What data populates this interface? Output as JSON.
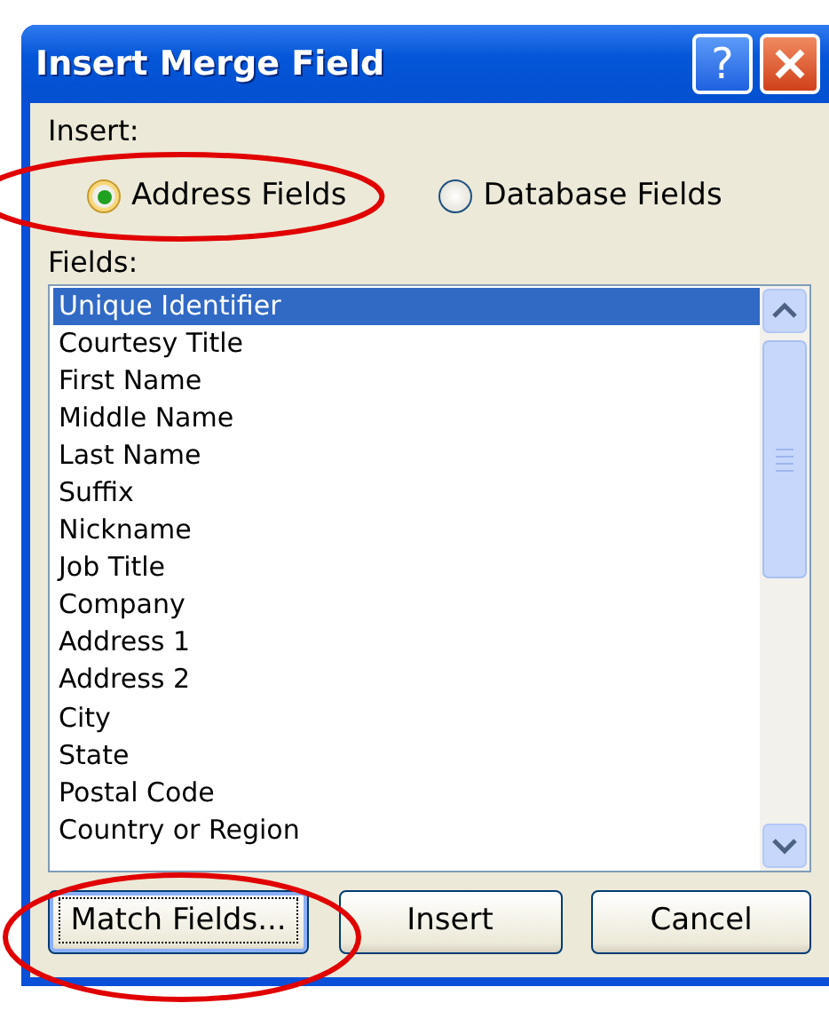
{
  "window": {
    "title": "Insert Merge Field",
    "help_button": "?"
  },
  "insert_label": "Insert:",
  "options": [
    {
      "label": "Address Fields",
      "selected": true,
      "circled": true
    },
    {
      "label": "Database Fields",
      "selected": false,
      "circled": false
    }
  ],
  "fields_label": "Fields:",
  "fields": [
    {
      "label": "Unique Identifier",
      "selected": true
    },
    {
      "label": "Courtesy Title",
      "selected": false
    },
    {
      "label": "First Name",
      "selected": false
    },
    {
      "label": "Middle Name",
      "selected": false
    },
    {
      "label": "Last Name",
      "selected": false
    },
    {
      "label": "Suffix",
      "selected": false
    },
    {
      "label": "Nickname",
      "selected": false
    },
    {
      "label": "Job Title",
      "selected": false
    },
    {
      "label": "Company",
      "selected": false
    },
    {
      "label": "Address 1",
      "selected": false
    },
    {
      "label": "Address 2",
      "selected": false
    },
    {
      "label": "City",
      "selected": false
    },
    {
      "label": "State",
      "selected": false
    },
    {
      "label": "Postal Code",
      "selected": false
    },
    {
      "label": "Country or Region",
      "selected": false
    }
  ],
  "buttons": [
    {
      "label": "Match Fields...",
      "focused": true,
      "circled": true
    },
    {
      "label": "Insert",
      "focused": false,
      "circled": false
    },
    {
      "label": "Cancel",
      "focused": false,
      "circled": false
    }
  ]
}
